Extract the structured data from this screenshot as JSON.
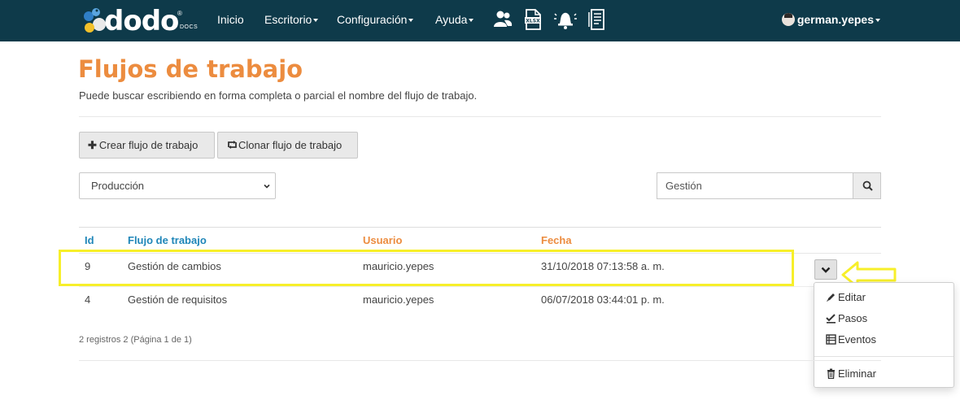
{
  "brand": {
    "name": "dodo",
    "registered": "®",
    "suffix": "DOCS",
    "colors": {
      "navbar": "#0e3a4a",
      "title": "#ec8c3f",
      "header_blue": "#1f86b8",
      "highlight": "#f7ef2a"
    }
  },
  "nav": {
    "items": [
      {
        "label": "Inicio",
        "dropdown": false
      },
      {
        "label": "Escritorio",
        "dropdown": true
      },
      {
        "label": "Configuración",
        "dropdown": true
      },
      {
        "label": "Ayuda",
        "dropdown": true
      }
    ],
    "icons": [
      "users-icon",
      "xlsx-file-icon",
      "bell-icon",
      "report-icon"
    ],
    "user": "german.yepes"
  },
  "page": {
    "title": "Flujos de trabajo",
    "subtitle": "Puede buscar escribiendo en forma completa o parcial el nombre del flujo de trabajo."
  },
  "toolbar": {
    "create_label": "Crear flujo de trabajo",
    "clone_label": "Clonar flujo de trabajo"
  },
  "filters": {
    "environment_selected": "Producción",
    "search_value": "Gestión"
  },
  "table": {
    "headers": {
      "id": "Id",
      "flujo": "Flujo de trabajo",
      "usuario": "Usuario",
      "fecha": "Fecha"
    },
    "rows": [
      {
        "id": "9",
        "flujo": "Gestión de cambios",
        "usuario": "mauricio.yepes",
        "fecha": "31/10/2018 07:13:58 a. m."
      },
      {
        "id": "4",
        "flujo": "Gestión de requisitos",
        "usuario": "mauricio.yepes",
        "fecha": "06/07/2018 03:44:01 p. m."
      }
    ]
  },
  "row_menu": {
    "edit": "Editar",
    "steps": "Pasos",
    "events": "Eventos",
    "delete": "Eliminar"
  },
  "pagination": {
    "summary": "2 registros 2 (Página 1 de 1)"
  }
}
